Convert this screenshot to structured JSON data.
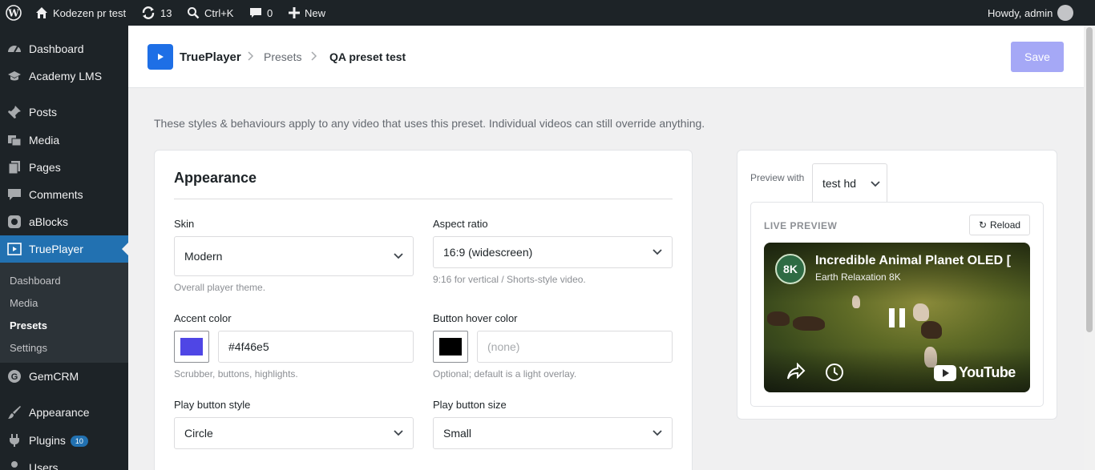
{
  "adminbar": {
    "site_name": "Kodezen pr test",
    "updates_count": "13",
    "search_shortcut": "Ctrl+K",
    "comments_count": "0",
    "new_label": "New",
    "howdy": "Howdy, admin"
  },
  "sidebar": {
    "items": [
      {
        "label": "Dashboard",
        "icon": "dashboard-icon"
      },
      {
        "label": "Academy LMS",
        "icon": "graduation-cap-icon"
      },
      {
        "label": "Posts",
        "icon": "pushpin-icon"
      },
      {
        "label": "Media",
        "icon": "media-icon"
      },
      {
        "label": "Pages",
        "icon": "pages-icon"
      },
      {
        "label": "Comments",
        "icon": "comment-icon"
      },
      {
        "label": "aBlocks",
        "icon": "ablocks-icon"
      },
      {
        "label": "TruePlayer",
        "icon": "video-icon"
      },
      {
        "label": "GemCRM",
        "icon": "gemcrm-icon"
      },
      {
        "label": "Appearance",
        "icon": "paintbrush-icon"
      },
      {
        "label": "Plugins",
        "icon": "plugin-icon",
        "badge": "10"
      },
      {
        "label": "Users",
        "icon": "users-icon"
      }
    ],
    "submenu": [
      "Dashboard",
      "Media",
      "Presets",
      "Settings"
    ],
    "current_submenu": "Presets"
  },
  "header": {
    "brand": "TruePlayer",
    "crumb_presets": "Presets",
    "crumb_current": "QA preset test",
    "save_label": "Save"
  },
  "intro_text": "These styles & behaviours apply to any video that uses this preset. Individual videos can still override anything.",
  "appearance": {
    "title": "Appearance",
    "skin": {
      "label": "Skin",
      "value": "Modern",
      "help": "Overall player theme."
    },
    "aspect_ratio": {
      "label": "Aspect ratio",
      "value": "16:9 (widescreen)",
      "help": "9:16 for vertical / Shorts-style video."
    },
    "accent_color": {
      "label": "Accent color",
      "value": "#4f46e5",
      "help": "Scrubber, buttons, highlights.",
      "swatch": "#4f46e5"
    },
    "button_hover_color": {
      "label": "Button hover color",
      "placeholder": "(none)",
      "help": "Optional; default is a light overlay.",
      "swatch": "#000000"
    },
    "play_button_style": {
      "label": "Play button style",
      "value": "Circle"
    },
    "play_button_size": {
      "label": "Play button size",
      "value": "Small"
    }
  },
  "preview": {
    "preview_with_label": "Preview with",
    "preview_video": "test hd",
    "live_label": "LIVE PREVIEW",
    "reload_label": "Reload",
    "video_title": "Incredible Animal Planet OLED [",
    "channel": "Earth Relaxation 8K",
    "avatar_text": "8K",
    "youtube_label": "YouTube"
  },
  "colors": {
    "wp_dark": "#1d2327",
    "wp_blue": "#2271b1",
    "brand_blue": "#1e6fe6",
    "save_disabled": "#a5a8f6"
  }
}
